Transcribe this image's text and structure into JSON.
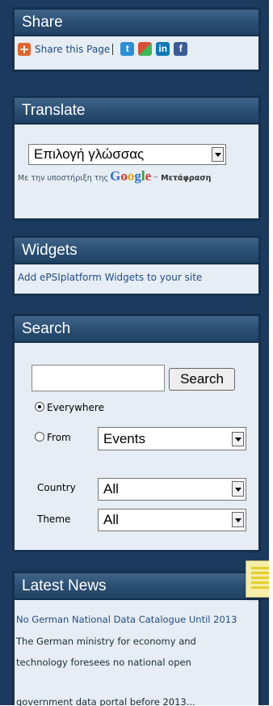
{
  "share": {
    "title": "Share",
    "text": "Share this Page"
  },
  "translate": {
    "title": "Translate",
    "selected": "Επιλογή γλώσσας",
    "powered_prefix": "Με την υποστήριξη της",
    "google": {
      "g1": "G",
      "o1": "o",
      "o2": "o",
      "g2": "g",
      "l": "l",
      "e": "e"
    },
    "tm": "™",
    "service": "Μετάφραση"
  },
  "widgets": {
    "title": "Widgets",
    "link": "Add ePSIplatform Widgets to your site"
  },
  "search": {
    "title": "Search",
    "button": "Search",
    "everywhere": "Everywhere",
    "from": "From",
    "from_value": "Events",
    "country_label": "Country",
    "country_value": "All",
    "theme_label": "Theme",
    "theme_value": "All"
  },
  "news": {
    "title": "Latest News",
    "headline": "No German National Data Catalogue Until 2013",
    "body": "The German ministry for economy and technology foresees no national open",
    "cut_line": "government data portal before 2013..."
  }
}
